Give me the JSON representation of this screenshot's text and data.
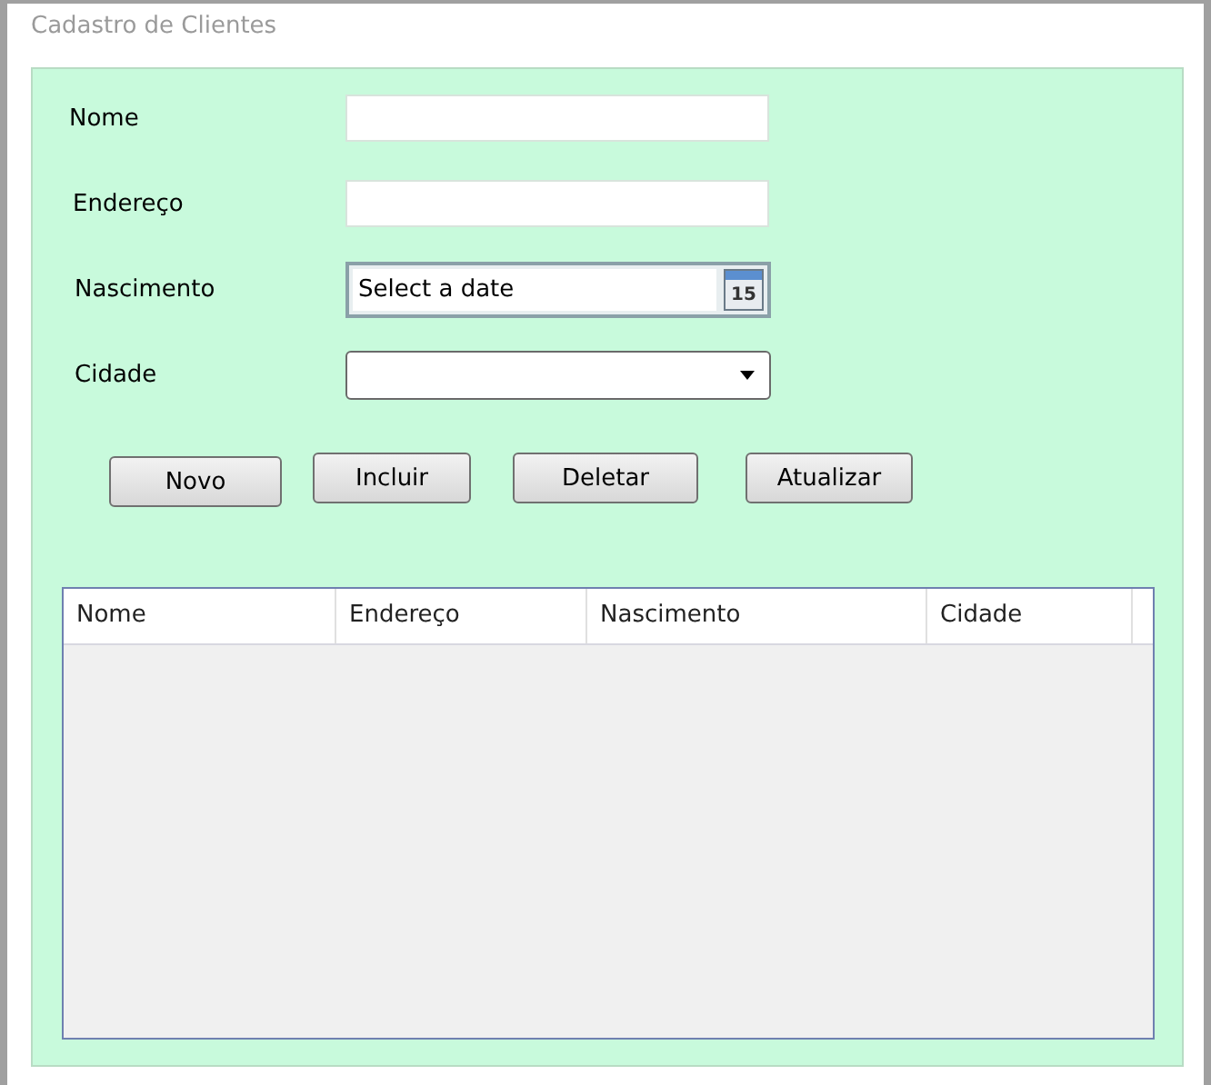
{
  "window": {
    "title": "Cadastro de Clientes"
  },
  "form": {
    "fields": [
      {
        "kind": "text",
        "label": "Nome"
      },
      {
        "kind": "text",
        "label": "Endereço"
      },
      {
        "kind": "date",
        "label": "Nascimento",
        "placeholder": "Select a date",
        "icon_text": "15"
      },
      {
        "kind": "combo",
        "label": "Cidade"
      }
    ]
  },
  "buttons": [
    "Novo",
    "Incluir",
    "Deletar",
    "Atualizar"
  ],
  "table": {
    "columns": [
      "Nome",
      "Endereço",
      "Nascimento",
      "Cidade"
    ]
  }
}
